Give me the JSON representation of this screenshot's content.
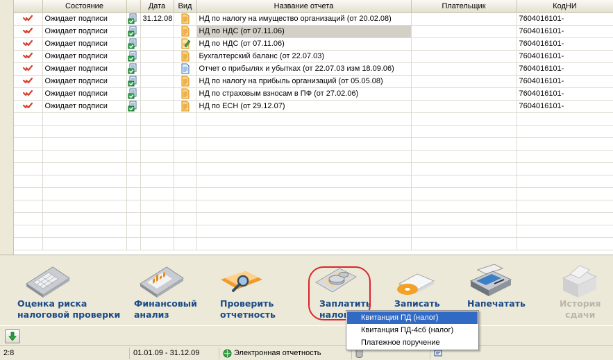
{
  "table": {
    "columns": [
      "",
      "Состояние",
      "",
      "Дата",
      "Вид",
      "Название отчета",
      "Плательщик",
      "КодНИ"
    ],
    "rows": [
      {
        "state": "Ожидает подписи",
        "date": "31.12.08",
        "vid": "doc-orange-icon",
        "name": "НД по налогу на имущество организаций (от 20.02.08)",
        "payer": "",
        "code": "7604016101-",
        "selected": false
      },
      {
        "state": "Ожидает подписи",
        "date": "",
        "vid": "doc-orange-icon",
        "name": "НД по НДС (от 07.11.06)",
        "payer": "",
        "code": "7604016101-",
        "selected": true
      },
      {
        "state": "Ожидает подписи",
        "date": "",
        "vid": "doc-edit-icon",
        "name": "НД по НДС (от 07.11.06)",
        "payer": "",
        "code": "7604016101-",
        "selected": false
      },
      {
        "state": "Ожидает подписи",
        "date": "",
        "vid": "doc-orange-icon",
        "name": "Бухгалтерский баланс (от 22.07.03)",
        "payer": "",
        "code": "7604016101-",
        "selected": false
      },
      {
        "state": "Ожидает подписи",
        "date": "",
        "vid": "doc-blue-icon",
        "name": "Отчет о прибылях и убытках (от 22.07.03 изм 18.09.06)",
        "payer": "",
        "code": "7604016101-",
        "selected": false
      },
      {
        "state": "Ожидает подписи",
        "date": "",
        "vid": "doc-orange-icon",
        "name": "НД по налогу на прибыль организаций (от 05.05.08)",
        "payer": "",
        "code": "7604016101-",
        "selected": false
      },
      {
        "state": "Ожидает подписи",
        "date": "",
        "vid": "doc-orange-icon",
        "name": "НД по страховым взносам в ПФ (от 27.02.06)",
        "payer": "",
        "code": "7604016101-",
        "selected": false
      },
      {
        "state": "Ожидает подписи",
        "date": "",
        "vid": "doc-orange-icon",
        "name": "НД по ЕСН (от 29.12.07)",
        "payer": "",
        "code": "7604016101-",
        "selected": false
      }
    ],
    "empty_rows": 11
  },
  "toolbar": {
    "risk_label": "Оценка риска\nналоговой проверки",
    "fin_label": "Финансовый\nанализ",
    "check_label": "Проверить\nотчетность",
    "pay_label": "Заплатить\nналог",
    "write_label": "Записать",
    "print_label": "Напечатать",
    "history_label": "История\nсдачи"
  },
  "popup": {
    "items": [
      "Квитанция ПД (налог)",
      "Квитанция ПД-4сб (налог)",
      "Платежное поручение"
    ]
  },
  "status": {
    "position": "2:8",
    "period": "01.01.09 - 31.12.09",
    "mode": "Электронная отчетность"
  },
  "colors": {
    "accent": "#1b4a86",
    "highlight": "#d9242b",
    "menu_selected": "#316ac5",
    "check": "#d8402c"
  }
}
